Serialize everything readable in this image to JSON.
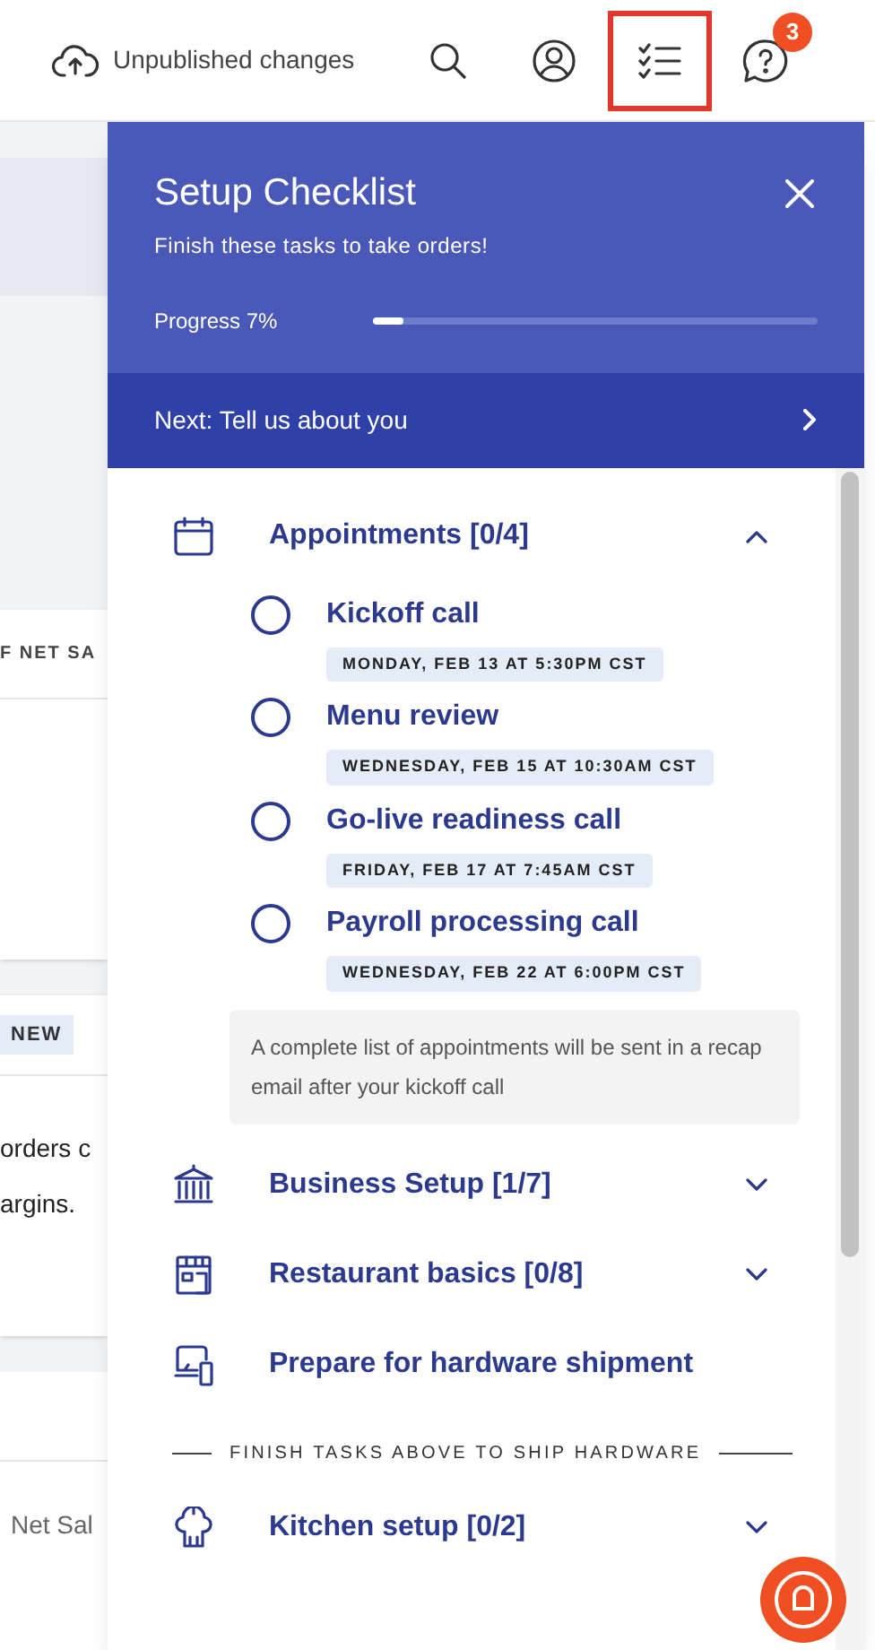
{
  "header": {
    "status": "Unpublished changes",
    "tools": [
      {
        "selected": false
      },
      {
        "selected": false
      },
      {
        "selected": true
      },
      {
        "selected": false,
        "badge": "3"
      }
    ]
  },
  "background": {
    "section_label": "F NET SA",
    "badge": "NEW",
    "lines": [
      "orders c",
      "argins."
    ],
    "footer": "Net Sal"
  },
  "checklist": {
    "title": "Setup Checklist",
    "subtitle": "Finish these tasks to take orders!",
    "progress_label": "Progress 7%",
    "level": 0.07,
    "next": "Next: Tell us about you",
    "items": [
      {
        "kind": "group",
        "title": "Appointments [0/4]",
        "expanded": true,
        "tasks": [
          {
            "title": "Kickoff call",
            "date": "MONDAY, FEB 13 AT 5:30PM CST",
            "checked": false
          },
          {
            "title": "Menu review",
            "date": "WEDNESDAY, FEB 15 AT 10:30AM CST",
            "checked": false
          },
          {
            "title": "Go-live readiness call",
            "date": "FRIDAY, FEB 17 AT 7:45AM CST",
            "checked": false
          },
          {
            "title": "Payroll processing call",
            "date": "WEDNESDAY, FEB 22 AT 6:00PM CST",
            "checked": false
          }
        ],
        "note": "A complete list of appointments will be sent in a recap email after your kickoff call"
      },
      {
        "kind": "group",
        "title": "Business Setup [1/7]",
        "expanded": false
      },
      {
        "kind": "group",
        "title": "Restaurant basics [0/8]",
        "expanded": false
      },
      {
        "kind": "link",
        "title": "Prepare for hardware shipment"
      },
      {
        "kind": "divider",
        "title": "FINISH TASKS ABOVE TO SHIP HARDWARE"
      },
      {
        "kind": "group",
        "title": "Kitchen setup [0/2]",
        "expanded": false
      }
    ]
  }
}
